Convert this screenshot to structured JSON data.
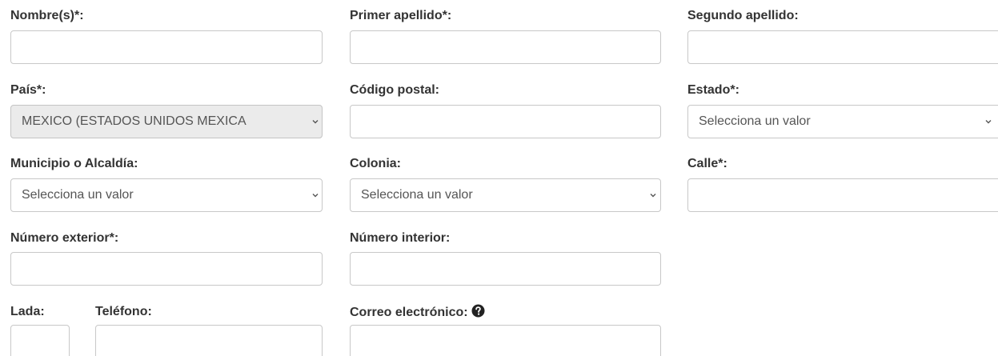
{
  "form": {
    "nombres": {
      "label": "Nombre(s)*:",
      "value": ""
    },
    "primer_apellido": {
      "label": "Primer apellido*:",
      "value": ""
    },
    "segundo_apellido": {
      "label": "Segundo apellido:",
      "value": ""
    },
    "pais": {
      "label": "País*:",
      "value": "MEXICO (ESTADOS UNIDOS MEXICA"
    },
    "codigo_postal": {
      "label": "Código postal:",
      "value": ""
    },
    "estado": {
      "label": "Estado*:",
      "value": "Selecciona un valor"
    },
    "municipio": {
      "label": "Municipio o Alcaldía:",
      "value": "Selecciona un valor"
    },
    "colonia": {
      "label": "Colonia:",
      "value": "Selecciona un valor"
    },
    "calle": {
      "label": "Calle*:",
      "value": ""
    },
    "numero_exterior": {
      "label": "Número exterior*:",
      "value": ""
    },
    "numero_interior": {
      "label": "Número interior:",
      "value": ""
    },
    "lada": {
      "label": "Lada:",
      "value": ""
    },
    "telefono": {
      "label": "Teléfono:",
      "value": ""
    },
    "correo": {
      "label": "Correo electrónico:",
      "value": "",
      "help_icon": "question-circle-icon"
    }
  },
  "colors": {
    "border": "#c8c8c8",
    "disabled_bg": "#ebebeb",
    "label": "#333333",
    "select_text": "#555555"
  }
}
